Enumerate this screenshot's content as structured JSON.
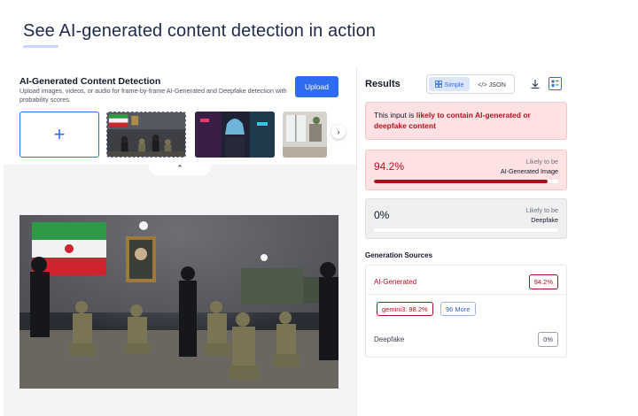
{
  "page": {
    "title": "See AI-generated content detection in action"
  },
  "upload_panel": {
    "heading": "AI-Generated Content Detection",
    "description": "Upload images, videos, or audio for frame-by-frame AI-Generated and Deepfake detection with probability scores.",
    "upload_label": "Upload",
    "add_symbol": "+",
    "next_symbol": "›",
    "collapse_symbol": "⌃"
  },
  "results": {
    "title": "Results",
    "view_simple": "Simple",
    "view_json": "</> JSON",
    "alert_prefix": "This input is ",
    "alert_emphasis": "likely to contain AI-generated or deepfake content",
    "ai_score": {
      "value_label": "94.2%",
      "value": 0.942,
      "caption_top": "Likely to be",
      "caption_main": "AI-Generated Image"
    },
    "deepfake_score": {
      "value_label": "0%",
      "value": 0,
      "caption_top": "Likely to be",
      "caption_main": "Deepfake"
    },
    "sources": {
      "title": "Generation Sources",
      "ai_label": "AI-Generated",
      "ai_badge": "94.2%",
      "gemini_chip": "gemini3: 98.2%",
      "more_chip": "96 More",
      "deepfake_label": "Deepfake",
      "deepfake_badge": "0%"
    }
  },
  "colors": {
    "accent": "#2f6df0",
    "danger": "#a5121d",
    "danger_bg": "#fde1e3"
  }
}
